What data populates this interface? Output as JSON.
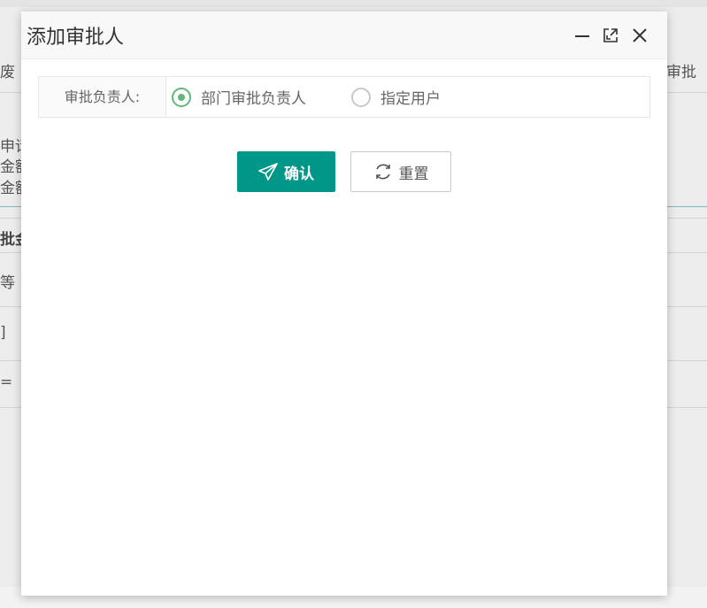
{
  "background": {
    "left_fragments": [
      "废",
      "申请",
      "金额",
      "金额",
      "批金",
      "等",
      "]",
      "="
    ],
    "right_fragment": "审批"
  },
  "dialog": {
    "title": "添加审批人",
    "header_icons": [
      "minimize-icon",
      "maximize-icon",
      "close-icon"
    ],
    "form": {
      "label": "审批负责人:",
      "radios": [
        {
          "label": "部门审批负责人",
          "checked": true
        },
        {
          "label": "指定用户",
          "checked": false
        }
      ]
    },
    "buttons": {
      "confirm_label": "确认",
      "confirm_icon": "send-icon",
      "reset_label": "重置",
      "reset_icon": "refresh-icon"
    },
    "colors": {
      "primary": "#009688",
      "radio_checked": "#5fb878"
    }
  }
}
